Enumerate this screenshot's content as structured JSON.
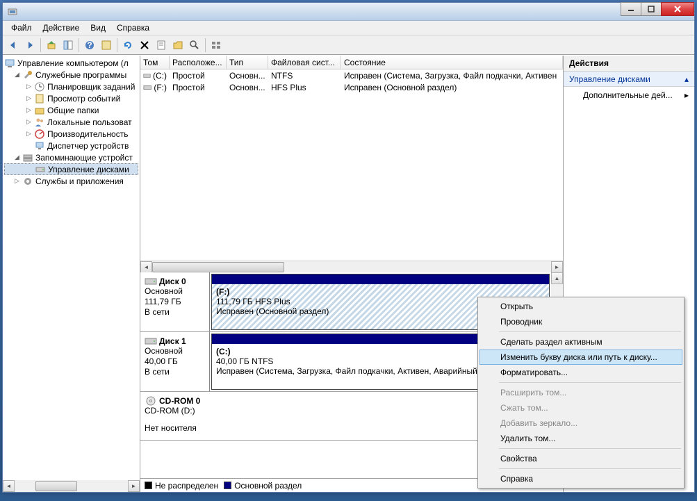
{
  "window": {
    "title": ""
  },
  "menu": {
    "file": "Файл",
    "action": "Действие",
    "view": "Вид",
    "help": "Справка"
  },
  "tree": {
    "root": "Управление компьютером (л",
    "group1": "Служебные программы",
    "scheduler": "Планировщик заданий",
    "events": "Просмотр событий",
    "shared": "Общие папки",
    "users": "Локальные пользоват",
    "perf": "Производительность",
    "devmgr": "Диспетчер устройств",
    "group2": "Запоминающие устройст",
    "diskmgmt": "Управление дисками",
    "group3": "Службы и приложения"
  },
  "cols": {
    "vol": "Том",
    "layout": "Расположе...",
    "type": "Тип",
    "fs": "Файловая сист...",
    "status": "Состояние"
  },
  "vols": [
    {
      "name": "(C:)",
      "layout": "Простой",
      "type": "Основн...",
      "fs": "NTFS",
      "status": "Исправен (Система, Загрузка, Файл подкачки, Активен"
    },
    {
      "name": "(F:)",
      "layout": "Простой",
      "type": "Основн...",
      "fs": "HFS Plus",
      "status": "Исправен (Основной раздел)"
    }
  ],
  "disks": [
    {
      "name": "Диск 0",
      "kind": "Основной",
      "size": "111,79 ГБ",
      "state": "В сети",
      "part": {
        "letter": "(F:)",
        "desc": "111,79 ГБ HFS Plus",
        "status": "Исправен (Основной раздел)"
      }
    },
    {
      "name": "Диск 1",
      "kind": "Основной",
      "size": "40,00 ГБ",
      "state": "В сети",
      "part": {
        "letter": "(C:)",
        "desc": "40,00 ГБ NTFS",
        "status": "Исправен (Система, Загрузка, Файл подкачки, Активен, Аварийный"
      }
    }
  ],
  "cdrom": {
    "name": "CD-ROM 0",
    "kind": "CD-ROM (D:)",
    "state": "Нет носителя"
  },
  "legend": {
    "unalloc": "Не распределен",
    "primary": "Основной раздел"
  },
  "actions": {
    "title": "Действия",
    "section": "Управление дисками",
    "more": "Дополнительные дей..."
  },
  "ctx": {
    "open": "Открыть",
    "explorer": "Проводник",
    "active": "Сделать раздел активным",
    "changeletter": "Изменить букву диска или путь к диску...",
    "format": "Форматировать...",
    "extend": "Расширить том...",
    "shrink": "Сжать том...",
    "mirror": "Добавить зеркало...",
    "delete": "Удалить том...",
    "props": "Свойства",
    "help": "Справка"
  }
}
